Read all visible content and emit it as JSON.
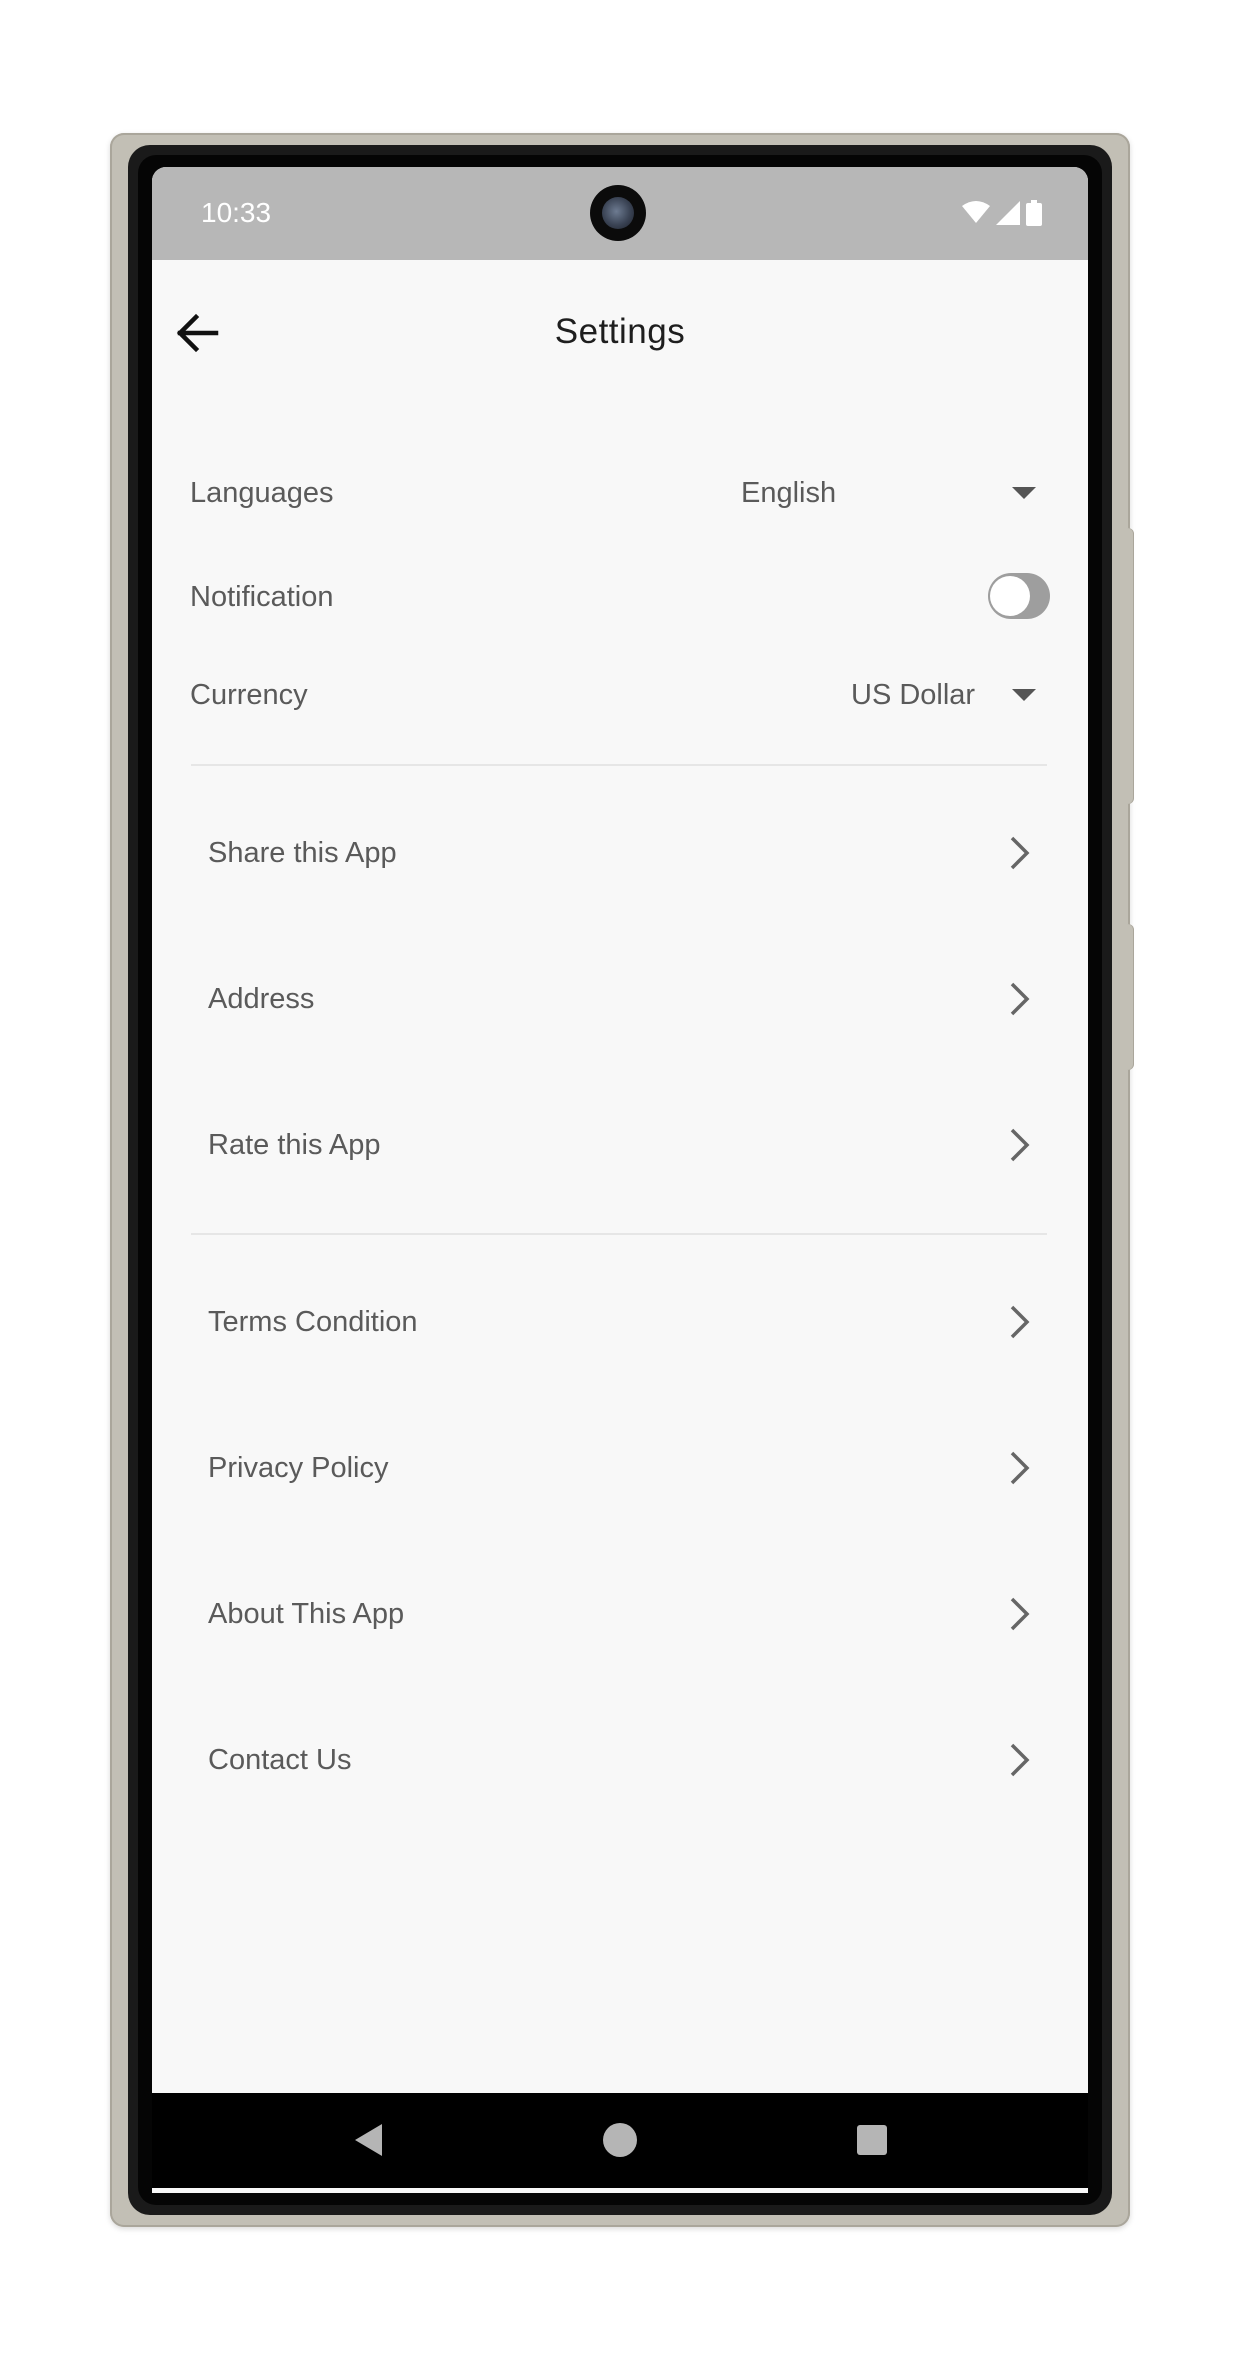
{
  "status_bar": {
    "time": "10:33",
    "icons": [
      "wifi-icon",
      "cellular-signal-icon",
      "battery-icon"
    ]
  },
  "header": {
    "title": "Settings",
    "back_icon": "arrow-left-icon"
  },
  "preferences": {
    "language": {
      "label": "Languages",
      "value": "English"
    },
    "notification": {
      "label": "Notification",
      "enabled": false
    },
    "currency": {
      "label": "Currency",
      "value": "US Dollar"
    }
  },
  "menu_group_1": [
    {
      "label": "Share this App"
    },
    {
      "label": "Address"
    },
    {
      "label": "Rate this App"
    }
  ],
  "menu_group_2": [
    {
      "label": "Terms Condition"
    },
    {
      "label": "Privacy Policy"
    },
    {
      "label": "About This App"
    },
    {
      "label": "Contact Us"
    }
  ],
  "system_nav": {
    "icons": [
      "nav-back-icon",
      "nav-home-icon",
      "nav-recents-icon"
    ]
  },
  "colors": {
    "status_bar_bg": "#b7b7b7",
    "screen_bg": "#f8f8f8",
    "text_primary": "#1e1e1e",
    "text_secondary": "#5a5a5a",
    "toggle_off": "#9e9e9e",
    "phone_frame": "#c2bfb5"
  }
}
